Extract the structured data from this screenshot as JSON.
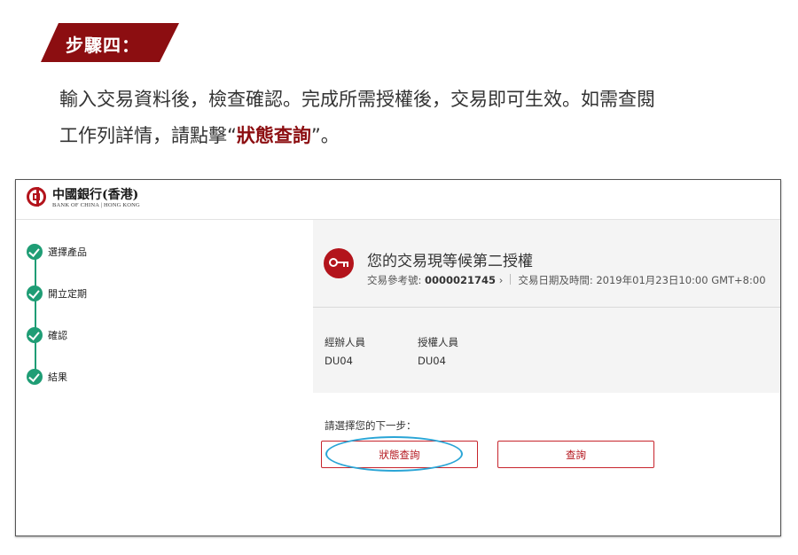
{
  "step_heading": "步驟四：",
  "instructions": {
    "line1": "輸入交易資料後，檢查確認。完成所需授權後，交易即可生效。如需查閱",
    "line2_before": "工作列詳情，請點擊“",
    "line2_highlight": "狀態查詢",
    "line2_after": "”。"
  },
  "app": {
    "logo_chinese": "中國銀行(香港)",
    "logo_english": "BANK OF CHINA | HONG KONG",
    "steps": [
      {
        "label": "選擇產品",
        "completed": true
      },
      {
        "label": "開立定期",
        "completed": true
      },
      {
        "label": "確認",
        "completed": true
      },
      {
        "label": "結果",
        "completed": true
      }
    ],
    "status_title": "您的交易現等候第二授權",
    "ref_label": "交易參考號:",
    "ref_number": "0000021745",
    "ref_chevron": "›",
    "datetime_label": "交易日期及時間:",
    "datetime_value": "2019年01月23日10:00 GMT+8:00",
    "operator_label": "經辦人員",
    "operator_value": "DU04",
    "authorizer_label": "授權人員",
    "authorizer_value": "DU04",
    "next_step_label": "請選擇您的下一步：",
    "status_button": "狀態查詢",
    "query_button": "查詢"
  },
  "colors": {
    "brand_red": "#8c0e11",
    "button_red": "#b3141c",
    "step_green": "#1f9d75",
    "highlight_blue": "#2aa5d6"
  },
  "icons": [
    "check-icon",
    "key-icon",
    "chevron-right-icon",
    "bank-logo"
  ]
}
